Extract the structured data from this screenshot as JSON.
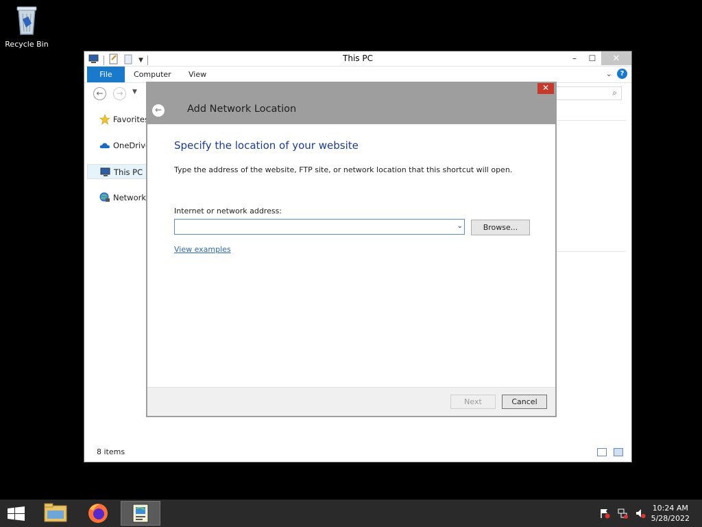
{
  "desktop": {
    "recycle_bin_label": "Recycle Bin"
  },
  "explorer": {
    "title": "This PC",
    "window_buttons": {
      "minimize": "–",
      "maximize": "☐",
      "close": "✕"
    },
    "ribbon": {
      "file_tab": "File",
      "tabs": [
        "Computer",
        "View"
      ],
      "expand": "⌄",
      "help": "?"
    },
    "nav": {
      "back": "←",
      "forward": "→",
      "recent_dropdown": "▼",
      "search_icon": "⌕"
    },
    "sidebar": {
      "items": [
        {
          "label": "Favorites",
          "icon": "star-icon"
        },
        {
          "label": "OneDrive",
          "icon": "cloud-icon"
        },
        {
          "label": "This PC",
          "icon": "computer-icon",
          "selected": true
        },
        {
          "label": "Network",
          "icon": "network-icon"
        }
      ]
    },
    "status_bar": {
      "item_count": "8 items"
    }
  },
  "dialog": {
    "title": "Add Network Location",
    "close_icon": "✕",
    "back_icon": "←",
    "heading": "Specify the location of your website",
    "description": "Type the address of the website, FTP site, or network location that this shortcut will open.",
    "address_label": "Internet or network address:",
    "address_value": "",
    "address_dropdown": "⌄",
    "browse_button": "Browse...",
    "view_examples_link": "View examples",
    "next_button": "Next",
    "cancel_button": "Cancel"
  },
  "taskbar": {
    "apps": [
      "file-explorer",
      "firefox",
      "network-location-wizard"
    ],
    "clock": {
      "time": "10:24 AM",
      "date": "5/28/2022"
    }
  },
  "colors": {
    "accent": "#1979ca",
    "heading": "#1c3c8c",
    "link": "#2a6aa8",
    "dialog_header": "#9e9e9e",
    "taskbar": "#2a2a2a"
  }
}
